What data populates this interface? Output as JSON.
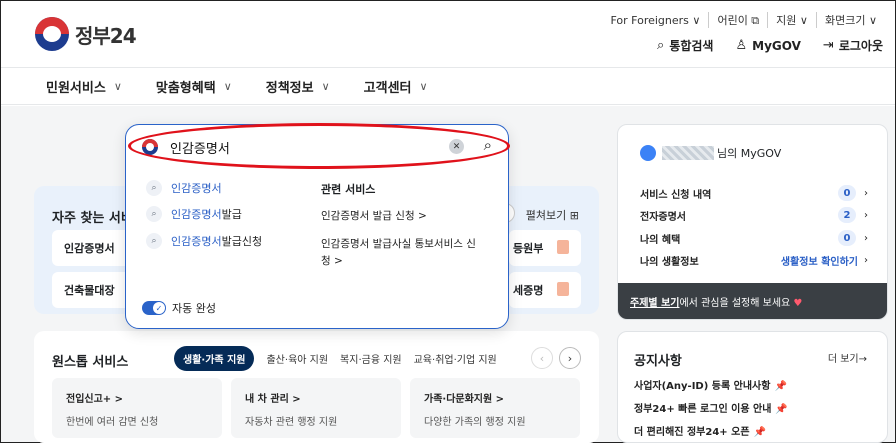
{
  "header": {
    "logo_text": "정부24",
    "util_links": [
      "For Foreigners ∨",
      "어린이 ⧉",
      "지원 ∨",
      "화면크기 ∨"
    ],
    "search_label": "통합검색",
    "mygov_label": "MyGOV",
    "logout_label": "로그아웃"
  },
  "nav": {
    "items": [
      "민원서비스",
      "맞춤형혜택",
      "정책정보",
      "고객센터"
    ]
  },
  "search": {
    "value": "인감증명서",
    "suggestions": [
      {
        "highlight": "인감증명서",
        "rest": ""
      },
      {
        "highlight": "인감증명서",
        "rest": "발급"
      },
      {
        "highlight": "인감증명서",
        "rest": "발급신청"
      }
    ],
    "related_title": "관련 서비스",
    "related": [
      "인감증명서 발급 신청 >",
      "인감증명서 발급사실 통보서비스 신",
      "청 >"
    ],
    "autocomplete_label": "자동 완성"
  },
  "frequent": {
    "title": "자주 찾는 서비",
    "more_label": "펼쳐보기 ⊞",
    "tiles": [
      "인감증명서",
      "건축물대장",
      "등원부",
      "세증명"
    ]
  },
  "onestop": {
    "title": "원스톱 서비스",
    "chips": [
      "생활·가족 지원",
      "출산·육아 지원",
      "복지·금융 지원",
      "교육·취업·기업 지원"
    ],
    "cards": [
      {
        "title": "전입신고+ >",
        "desc": "한번에 여러 감면 신청"
      },
      {
        "title": "내 차 관리 >",
        "desc": "자동차 관련 행정 지원"
      },
      {
        "title": "가족·다문화지원 >",
        "desc": "다양한 가족의 행정 지원"
      }
    ]
  },
  "mygov_panel": {
    "greeting": "님의 MyGOV",
    "rows": [
      {
        "label": "서비스 신청 내역",
        "count": "0"
      },
      {
        "label": "전자증명서",
        "count": "2"
      },
      {
        "label": "나의 혜택",
        "count": "0"
      }
    ],
    "life_label": "나의 생활정보",
    "life_link": "생활정보 확인하기",
    "footer_link": "주제별 보기",
    "footer_text": "에서 관심을 설정해 보세요"
  },
  "notice": {
    "title": "공지사항",
    "more_label": "더 보기→",
    "items": [
      "사업자(Any-ID) 등록 안내사항",
      "정부24+ 빠른 로그인 이용 안내",
      "더 편리해진 정부24+ 오픈"
    ]
  }
}
